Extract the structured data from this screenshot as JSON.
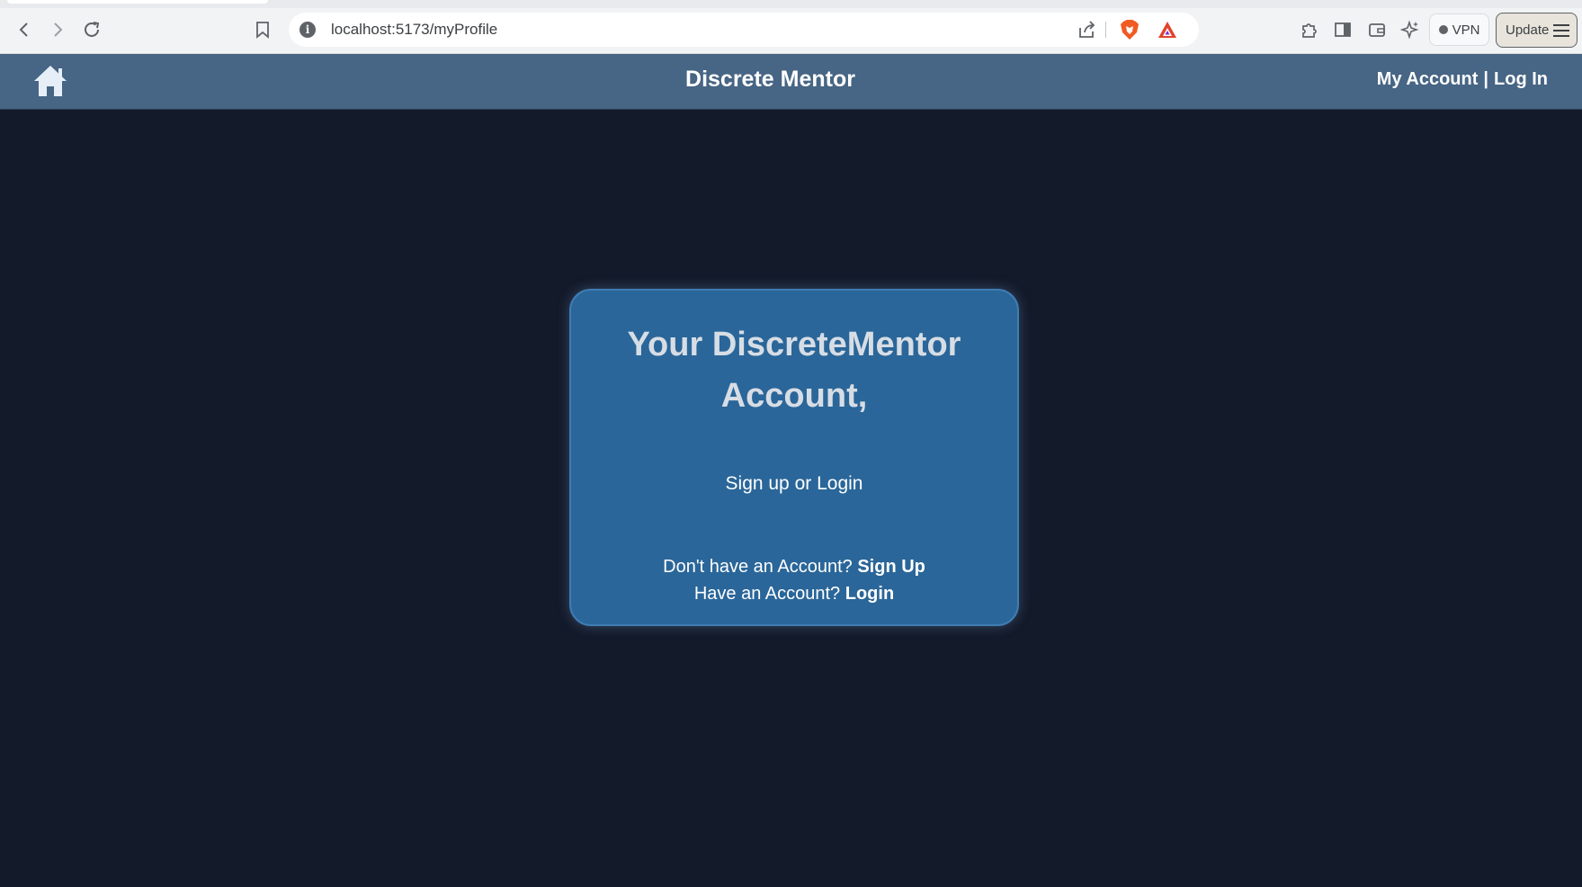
{
  "browser": {
    "url": "localhost:5173/myProfile",
    "vpn_label": "VPN",
    "update_label": "Update"
  },
  "header": {
    "title": "Discrete Mentor",
    "my_account": "My Account",
    "separator": "|",
    "login": "Log In"
  },
  "card": {
    "title_line1": "Your DiscreteMentor",
    "title_line2": "Account,",
    "subtitle": "Sign up or Login",
    "signup_prompt": "Don't have an Account?",
    "signup_link": "Sign Up",
    "login_prompt": "Have an Account?",
    "login_link": "Login"
  },
  "icons": {
    "back": "chevron-left-icon",
    "forward": "chevron-right-icon",
    "reload": "reload-icon",
    "bookmark": "bookmark-icon",
    "info": "info-icon",
    "share": "share-icon",
    "brave": "brave-shields-icon",
    "rewards": "brave-rewards-icon",
    "extensions": "puzzle-icon",
    "sidebar": "sidebar-icon",
    "wallet": "wallet-icon",
    "leo": "leo-sparkle-icon",
    "home": "home-icon",
    "menu": "hamburger-icon"
  },
  "colors": {
    "page_background": "#131a2a",
    "header_background": "#476584",
    "card_background": "#2a6699",
    "card_title": "#d7dde5",
    "brave_orange": "#f15a22"
  }
}
